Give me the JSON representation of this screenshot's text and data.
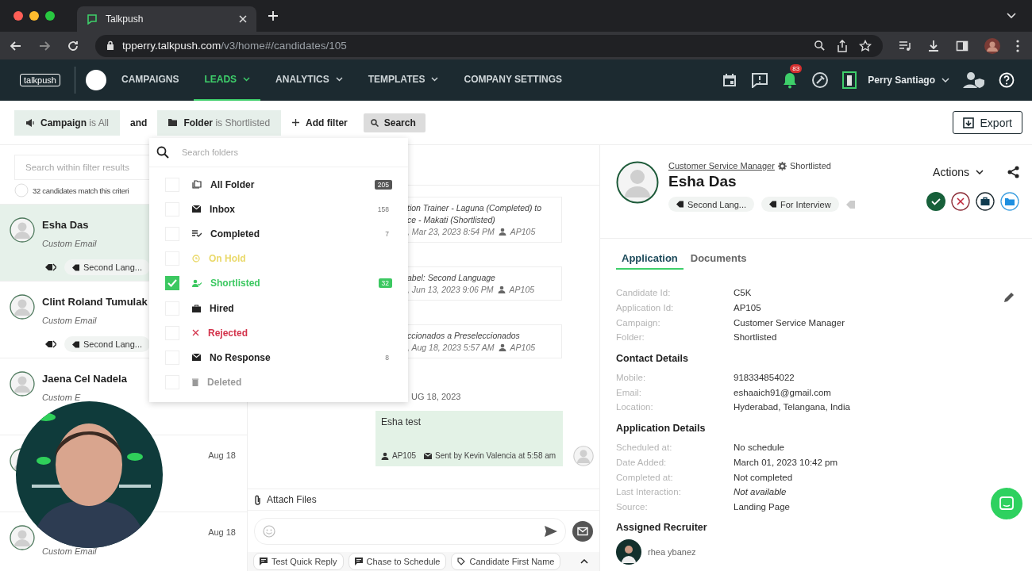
{
  "browser": {
    "tab_title": "Talkpush",
    "url_host": "tpperry.talkpush.com",
    "url_path": "/v3/home#/candidates/105"
  },
  "nav": {
    "logo": "talkpush",
    "items": [
      {
        "label": "CAMPAIGNS",
        "selected": false,
        "has_menu": false
      },
      {
        "label": "LEADS",
        "selected": true,
        "has_menu": true
      },
      {
        "label": "ANALYTICS",
        "selected": false,
        "has_menu": true
      },
      {
        "label": "TEMPLATES",
        "selected": false,
        "has_menu": true
      },
      {
        "label": "COMPANY SETTINGS",
        "selected": false,
        "has_menu": false
      }
    ],
    "notifications": "83",
    "user": "Perry Santiago"
  },
  "filters": {
    "chips": [
      {
        "kind": "campaign",
        "text": "**Campaign** is All"
      },
      {
        "kind": "folder",
        "text": "**Folder** is Shortlisted"
      }
    ],
    "joiner": "and",
    "add_filter": "Add filter",
    "search": "Search",
    "export": "Export"
  },
  "folder_menu": {
    "placeholder": "Search folders",
    "folders": [
      {
        "kind": "all",
        "label": "All Folder",
        "count": "205",
        "checked": false,
        "color": "#222222"
      },
      {
        "kind": "inbox",
        "label": "Inbox",
        "count": "158",
        "checked": false,
        "color": "#222222"
      },
      {
        "kind": "completed",
        "label": "Completed",
        "count": "7",
        "checked": false,
        "color": "#222222"
      },
      {
        "kind": "on_hold",
        "label": "On Hold",
        "checked": false,
        "color": "#ead96a"
      },
      {
        "kind": "shortlisted",
        "label": "Shortlisted",
        "count": "32",
        "checked": true,
        "color": "#3cc861"
      },
      {
        "kind": "hired",
        "label": "Hired",
        "checked": false,
        "color": "#222222"
      },
      {
        "kind": "rejected",
        "label": "Rejected",
        "checked": false,
        "color": "#d3334b"
      },
      {
        "kind": "no_response",
        "label": "No Response",
        "count": "8",
        "checked": false,
        "color": "#222222"
      },
      {
        "kind": "deleted",
        "label": "Deleted",
        "checked": false,
        "color": "#9a9a9a"
      }
    ]
  },
  "candidates": {
    "search_placeholder": "Search within filter results",
    "match_text": "32 candidates match this criteri",
    "match_checked": false,
    "items": [
      {
        "name": "Esha Das",
        "subtitle": "Custom Email",
        "tag": "Second Lang...",
        "selected": true
      },
      {
        "name": "Clint Roland Tumulak",
        "subtitle": "Custom Email",
        "tag": "Second Lang...",
        "selected": false
      },
      {
        "name": "Jaena Cel Nadela",
        "subtitle": "Custom E",
        "selected": false
      },
      {
        "date": "Aug 18",
        "selected": false
      },
      {
        "subtitle": "Custom Email",
        "date": "Aug 18",
        "selected": false
      }
    ]
  },
  "conversation": {
    "messages": [
      {
        "lines": [
          "tion Trainer - Laguna (Completed) to",
          "ce - Makati (Shortlisted)"
        ],
        "meta": ", Mar 23, 2023 8:54 PM",
        "author": "AP105"
      },
      {
        "lines": [
          "abel: Second Language"
        ],
        "meta": ", Jun 13, 2023 9:06 PM",
        "author": "AP105"
      },
      {
        "lines": [
          "ccionados a Preseleccionados"
        ],
        "meta": ", Aug 18, 2023 5:57 AM",
        "author": "AP105"
      }
    ],
    "date_label": "UG 18, 2023",
    "bubble": {
      "text": "Esha test",
      "author": "AP105",
      "sent_by": "Sent by Kevin Valencia at 5:58 am"
    },
    "attach": "Attach Files",
    "quick_replies": [
      {
        "kind": "reply",
        "label": "Test Quick Reply"
      },
      {
        "kind": "reply",
        "label": "Chase to Schedule"
      },
      {
        "kind": "tag",
        "label": "Candidate First Name"
      }
    ]
  },
  "profile": {
    "campaign_link": "Customer Service Manager",
    "status": "Shortlisted",
    "name": "Esha Das",
    "tags": [
      "Second Lang...",
      "For Interview"
    ],
    "actions": "Actions",
    "tabs": [
      {
        "label": "Application",
        "selected": true
      },
      {
        "label": "Documents",
        "selected": false
      }
    ],
    "sections": [
      {
        "rows": [
          {
            "label": "Candidate Id:",
            "value": "C5K",
            "italic": false
          },
          {
            "label": "Application Id:",
            "value": "AP105",
            "italic": false
          },
          {
            "label": "Campaign:",
            "value": "Customer Service Manager",
            "italic": false
          },
          {
            "label": "Folder:",
            "value": "Shortlisted",
            "italic": false
          }
        ]
      },
      {
        "heading": "Contact Details",
        "rows": [
          {
            "label": "Mobile:",
            "value": "918334854022",
            "italic": false
          },
          {
            "label": "Email:",
            "value": "eshaaich91@gmail.com",
            "italic": false
          },
          {
            "label": "Location:",
            "value": "Hyderabad, Telangana, India",
            "italic": false
          }
        ]
      },
      {
        "heading": "Application Details",
        "rows": [
          {
            "label": "Scheduled at:",
            "value": "No schedule",
            "italic": false
          },
          {
            "label": "Date Added:",
            "value": "March 01, 2023 10:42 pm",
            "italic": false
          },
          {
            "label": "Completed at:",
            "value": "Not completed",
            "italic": false
          },
          {
            "label": "Last Interaction:",
            "value": "Not available",
            "italic": true
          },
          {
            "label": "Source:",
            "value": "Landing Page",
            "italic": false
          }
        ]
      },
      {
        "heading": "Assigned Recruiter"
      }
    ],
    "recruiter": "rhea ybanez"
  }
}
